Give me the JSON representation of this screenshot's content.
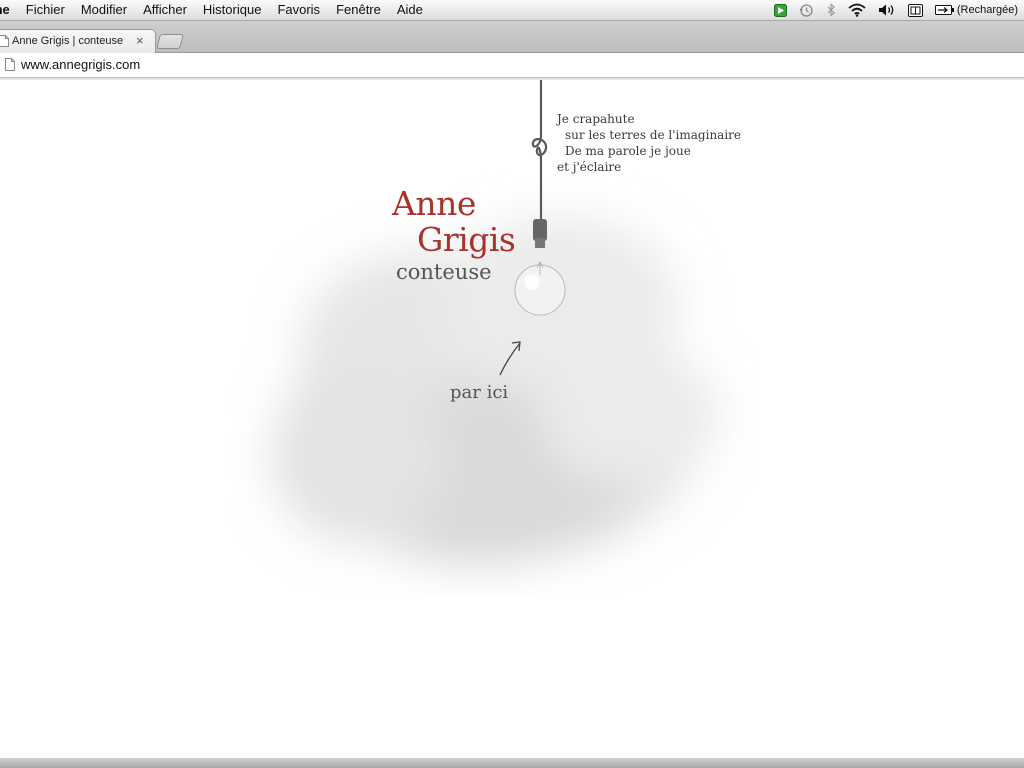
{
  "menubar": {
    "app": "me",
    "items": [
      "Fichier",
      "Modifier",
      "Afficher",
      "Historique",
      "Favoris",
      "Fenêtre",
      "Aide"
    ],
    "battery_text": "(Rechargée)",
    "status_icons": [
      "app-green-icon",
      "time-machine-icon",
      "bluetooth-icon",
      "wifi-icon",
      "volume-icon",
      "input-menu-icon",
      "battery-icon"
    ]
  },
  "browser": {
    "tab_title": "Anne Grigis | conteuse",
    "close_glyph": "×",
    "url": "www.annegrigis.com"
  },
  "page": {
    "poem": [
      "Je crapahute",
      "sur les terres de l'imaginaire",
      "De ma parole je joue",
      "et j'éclaire"
    ],
    "name_first": "Anne",
    "name_last": "Grigis",
    "subtitle": "conteuse",
    "link": "par ici",
    "colors": {
      "name": "#a8322c",
      "text": "#555555"
    }
  }
}
